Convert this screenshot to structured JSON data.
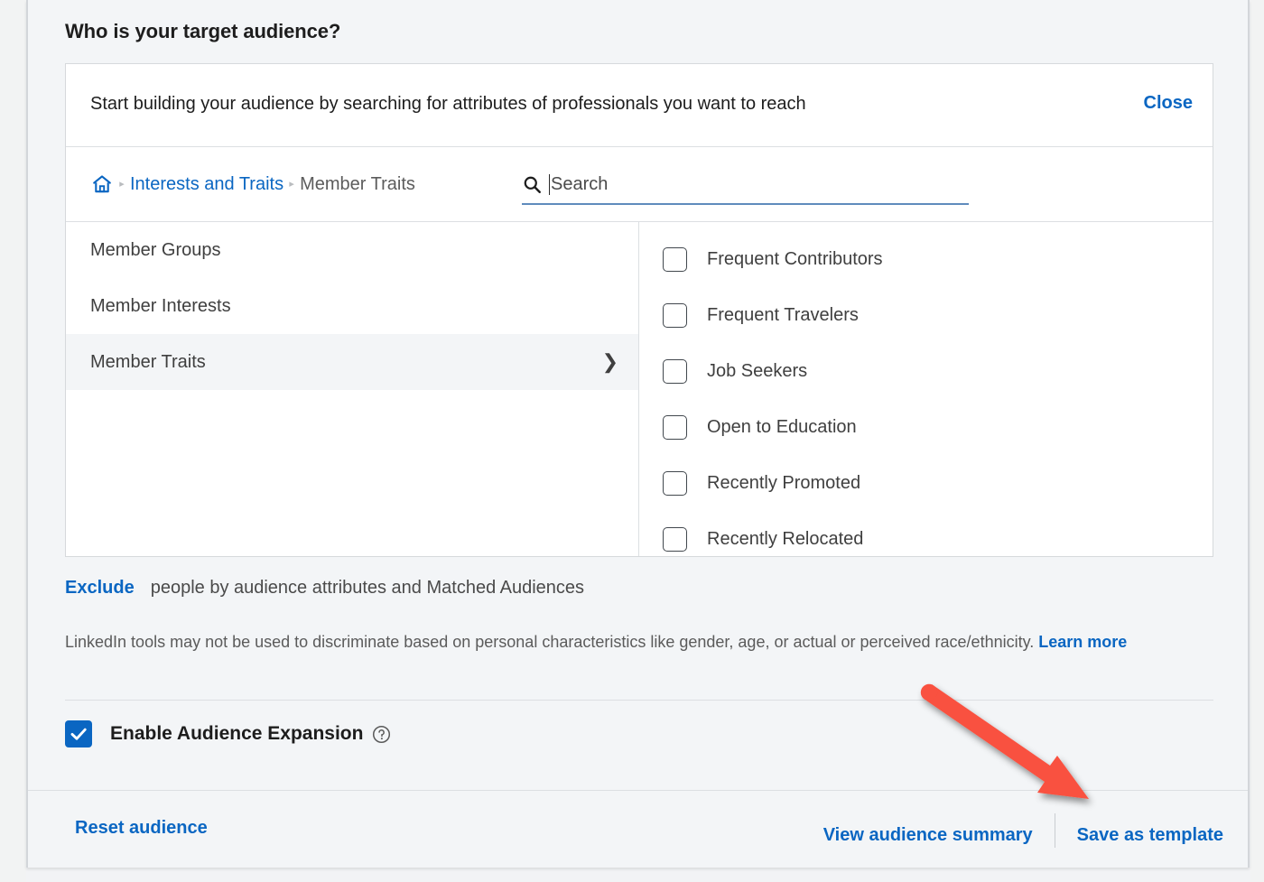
{
  "section": {
    "title": "Who is your target audience?"
  },
  "builder": {
    "header_text": "Start building your audience by searching for attributes of professionals you want to reach",
    "close_label": "Close",
    "breadcrumb": {
      "home_icon": "home-icon",
      "separator": "▸",
      "items": [
        {
          "label": "Interests and Traits",
          "state": "link"
        },
        {
          "label": "Member Traits",
          "state": "current"
        }
      ]
    },
    "search": {
      "icon": "search-icon",
      "placeholder": "Search",
      "value": ""
    },
    "categories": [
      {
        "label": "Member Groups",
        "selected": false,
        "chevron": ""
      },
      {
        "label": "Member Interests",
        "selected": false,
        "chevron": ""
      },
      {
        "label": "Member Traits",
        "selected": true,
        "chevron": "❯"
      }
    ],
    "options": [
      {
        "label": "Frequent Contributors",
        "checked": false
      },
      {
        "label": "Frequent Travelers",
        "checked": false
      },
      {
        "label": "Job Seekers",
        "checked": false
      },
      {
        "label": "Open to Education",
        "checked": false
      },
      {
        "label": "Recently Promoted",
        "checked": false
      },
      {
        "label": "Recently Relocated",
        "checked": false
      }
    ]
  },
  "exclude": {
    "link_label": "Exclude",
    "description": "people by audience attributes and Matched Audiences"
  },
  "legal": {
    "text": "LinkedIn tools may not be used to discriminate based on personal characteristics like gender, age, or actual or perceived race/ethnicity. ",
    "learn_more": "Learn more"
  },
  "expansion": {
    "label": "Enable Audience Expansion",
    "checked": true,
    "help_icon": "question-mark-circle-icon"
  },
  "footer": {
    "reset_label": "Reset audience",
    "summary_label": "View audience summary",
    "save_template_label": "Save as template"
  },
  "annotation": {
    "arrow_color": "#f9513f",
    "points_to": "Save as template"
  },
  "colors": {
    "link_blue": "#0a66c2",
    "text_dark": "#1d1d1d",
    "text_gray": "#5b5b5b",
    "page_bg": "#f3f5f7",
    "card_bg": "#ffffff",
    "border": "#dcdfe2",
    "annotation_red": "#f9513f"
  }
}
